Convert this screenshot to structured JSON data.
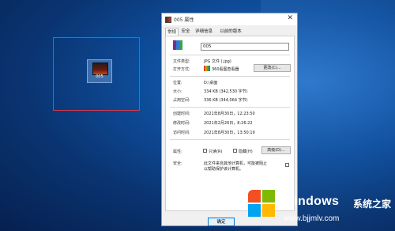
{
  "desktop": {
    "file_name": "005"
  },
  "dialog": {
    "title": "005 属性",
    "close_glyph": "✕",
    "tabs": [
      "常规",
      "安全",
      "详细信息",
      "以前的版本"
    ],
    "name_value": "005",
    "fields": {
      "type_label": "文件类型:",
      "type_value": "JPG 文件 (.jpg)",
      "open_with_label": "打开方式:",
      "open_with_value": "360看图查看器",
      "change_button": "更改(C)...",
      "location_label": "位置:",
      "location_value": "D:\\桌面",
      "size_label": "大小:",
      "size_value": "334 KB (342,530 字节)",
      "disk_size_label": "占用空间:",
      "disk_size_value": "336 KB (344,064 字节)",
      "created_label": "创建时间:",
      "created_value": "2021年8月30日，12:23:50",
      "modified_label": "修改时间:",
      "modified_value": "2021年2月26日，8:26:22",
      "accessed_label": "访问时间:",
      "accessed_value": "2021年8月30日，13:50:19",
      "attributes_label": "属性:",
      "readonly_label": "只读(R)",
      "hidden_label": "隐藏(H)",
      "advanced_button": "高级(D)...",
      "security_label": "安全:",
      "security_text_1": "此文件来自其他计算机，可能被阻止",
      "security_text_2": "以帮助保护该计算机。"
    },
    "buttons": {
      "ok": "确定"
    }
  },
  "watermark": {
    "brand": "Windows",
    "cn": "系统之家",
    "url": "www.bjjmlv.com"
  },
  "colors": {
    "desktop_bg": "#0f4f9e",
    "selection": "#d23a4e",
    "accent": "#0078d7"
  }
}
